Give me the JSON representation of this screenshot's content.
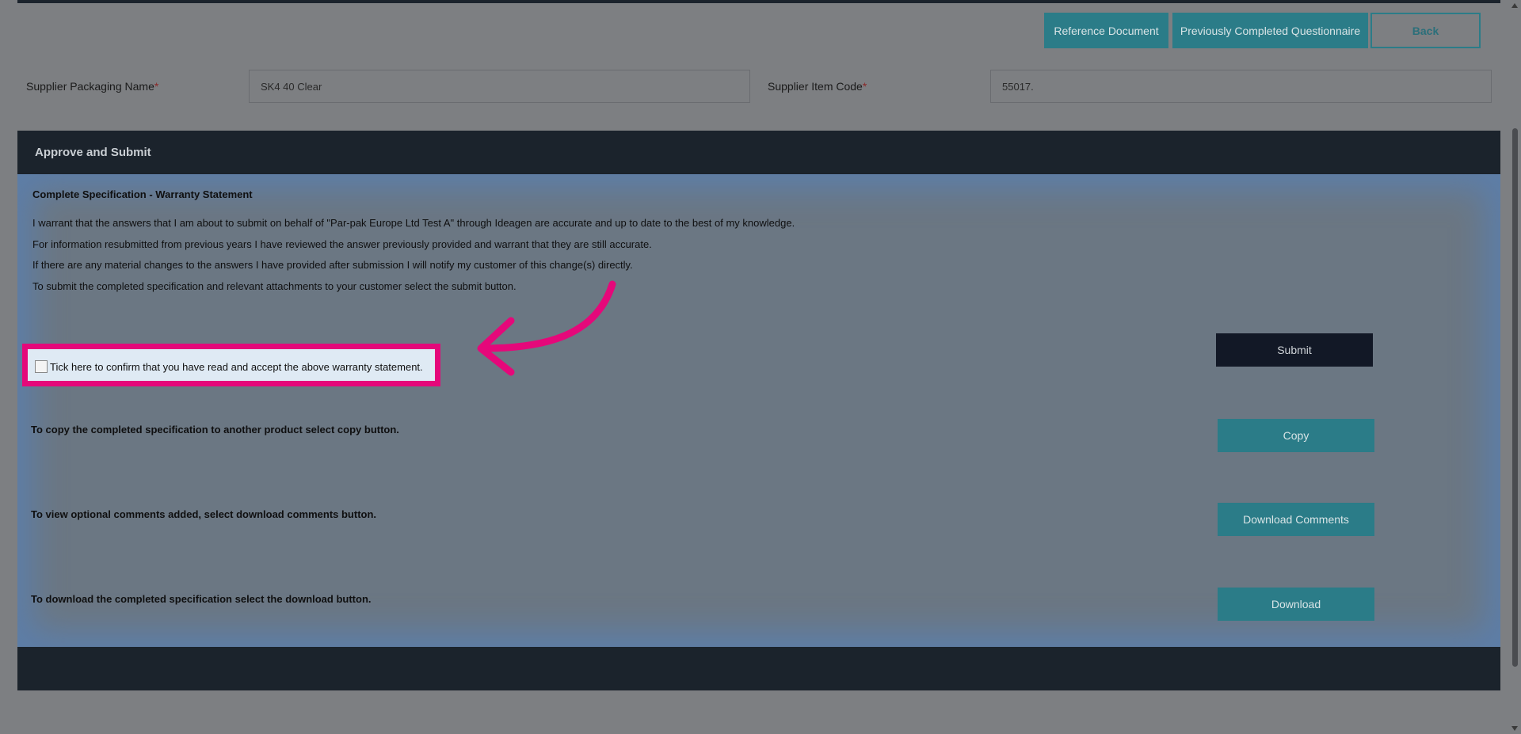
{
  "toolbar": {
    "reference_document": "Reference Document",
    "previously_completed": "Previously Completed Questionnaire",
    "back": "Back"
  },
  "fields": {
    "packaging_name_label": "Supplier Packaging Name",
    "packaging_name_value": "SK4 40 Clear",
    "item_code_label": "Supplier Item Code",
    "item_code_value": "55017.",
    "required_marker": "*"
  },
  "section": {
    "title": "Approve and Submit",
    "warranty_title": "Complete Specification - Warranty Statement",
    "warranty_lines": [
      "I warrant that the answers that I am about to submit on behalf of \"Par-pak Europe Ltd Test A\" through Ideagen are accurate and up to date to the best of my knowledge.",
      "For information resubmitted from previous years I have reviewed the answer previously provided and warrant that they are still accurate.",
      "If there are any material changes to the answers I have provided after submission I will notify my customer of this change(s) directly.",
      "To submit the completed specification and relevant attachments to your customer select the submit button."
    ],
    "confirm_label": "Tick here to confirm that you have read and accept the above warranty statement.",
    "submit_label": "Submit",
    "copy_text": "To copy the completed specification to another product select copy button.",
    "copy_label": "Copy",
    "comments_text": "To view optional comments added, select download comments button.",
    "comments_label": "Download Comments",
    "download_text": "To download the completed specification select the download button.",
    "download_label": "Download"
  },
  "colors": {
    "highlight": "#e5087a",
    "teal": "#2b7c88",
    "dark": "#1b232c"
  }
}
